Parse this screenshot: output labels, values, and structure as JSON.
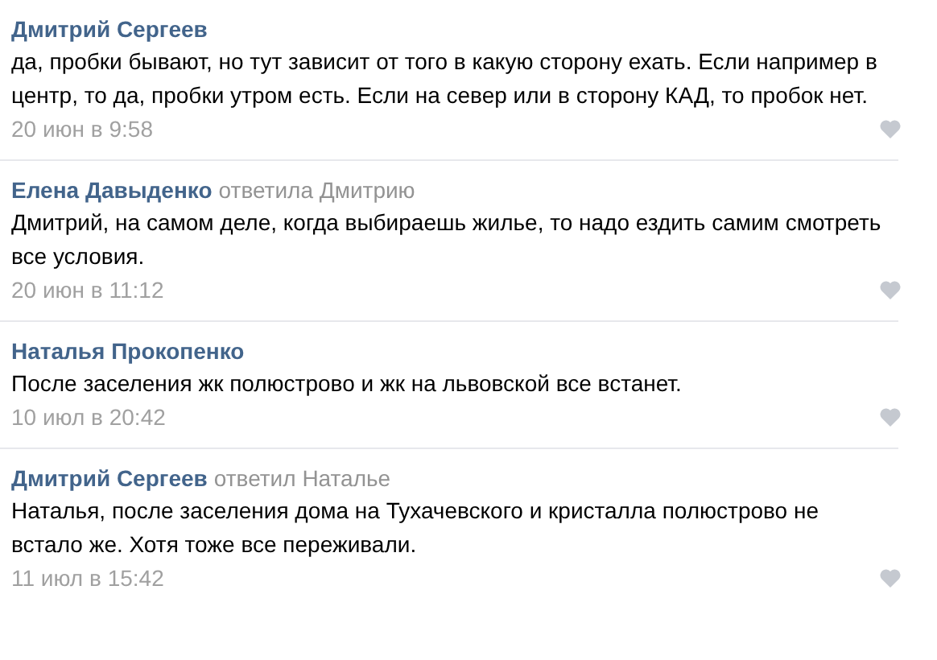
{
  "comments": [
    {
      "author": "Дмитрий Сергеев",
      "text": "да, пробки бывают, но тут зависит от того в какую сторону ехать. Если например в центр, то да, пробки утром есть. Если на север или в сторону КАД, то пробок нет.",
      "date": "20 июн в 9:58",
      "liked": false
    },
    {
      "author": "Елена Давыденко",
      "reply_to": "ответила Дмитрию",
      "text": "Дмитрий, на самом деле, когда выбираешь жилье, то надо ездить самим смотреть все условия.",
      "date": "20 июн в 11:12",
      "liked": false
    },
    {
      "author": "Наталья Прокопенко",
      "text": "После заселения жк полюстрово и жк на львовской все встанет.",
      "date": "10 июл в 20:42",
      "liked": false
    },
    {
      "author": "Дмитрий Сергеев",
      "reply_to": "ответил Наталье",
      "text": "Наталья, после заселения дома на Тухачевского и кристалла полюстрово не встало же. Хотя тоже все переживали.",
      "date": "11 июл в 15:42",
      "liked": false
    }
  ]
}
